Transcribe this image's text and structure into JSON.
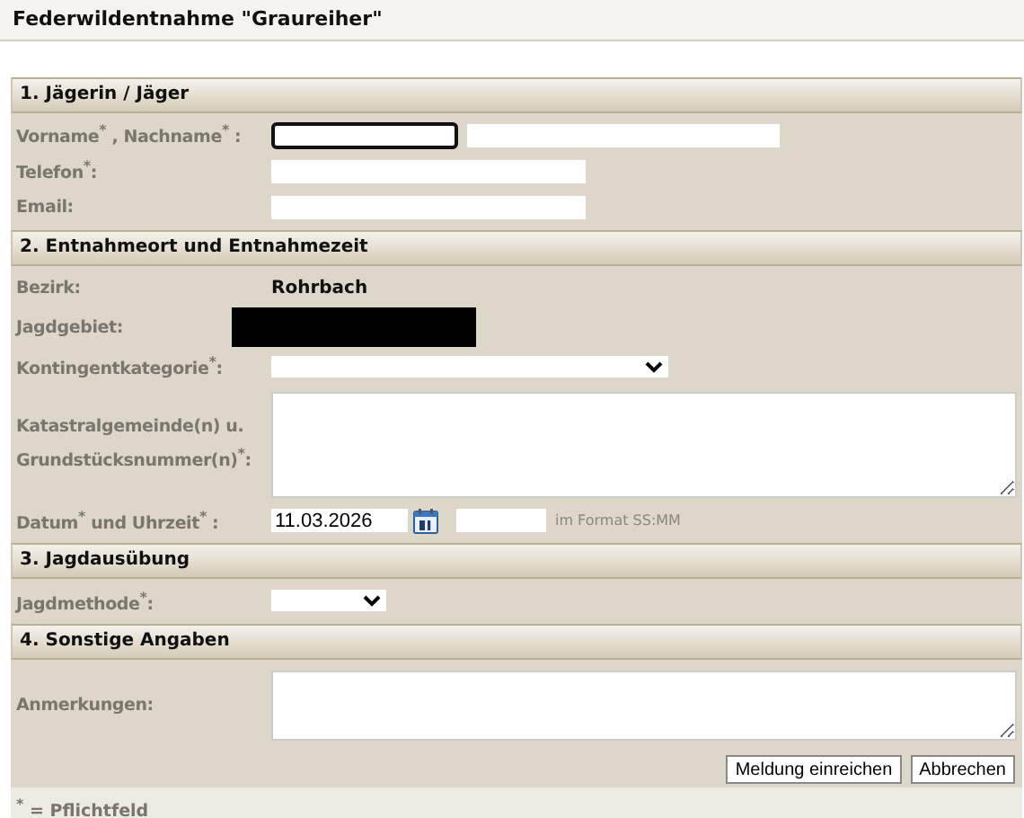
{
  "title": "Federwildentnahme \"Graureiher\"",
  "sections": [
    {
      "heading": "1. Jägerin / Jäger",
      "rows": [
        {
          "label": "Vorname$^{*}$ , Nachname$^{*}$ :",
          "fields": [
            {
              "kind": "text",
              "focused": true
            },
            {
              "kind": "text",
              "focused": false
            }
          ]
        },
        {
          "label": "Telefon$^{*}$:",
          "fields": [
            {
              "kind": "text",
              "focused": false
            }
          ]
        },
        {
          "label": "Email:",
          "fields": [
            {
              "kind": "text",
              "focused": false
            }
          ]
        }
      ]
    },
    {
      "heading": "2. Entnahmeort und Entnahmezeit",
      "rows": [
        {
          "label": "Bezirk:",
          "fields": [
            {
              "kind": "static",
              "text": "Rohrbach"
            }
          ]
        },
        {
          "label": "Jagdgebiet:",
          "fields": [
            {
              "kind": "redacted"
            }
          ]
        },
        {
          "label": "Kontingentkategorie$^{*}$:",
          "fields": [
            {
              "kind": "select"
            }
          ]
        },
        {
          "label": "Katastralgemeinde(n) u. Grundstücksnummer(n)$^{*}$:",
          "fields": [
            {
              "kind": "textarea"
            }
          ]
        },
        {
          "label": "Datum$^{*}$  und Uhrzeit$^{*}$ :",
          "fields": [
            {
              "kind": "date",
              "value": "11.03.2026"
            },
            {
              "kind": "calendar"
            },
            {
              "kind": "time"
            },
            {
              "kind": "hint",
              "text": "im Format SS:MM"
            }
          ]
        }
      ]
    },
    {
      "heading": "3. Jagdausübung",
      "rows": [
        {
          "label": "Jagdmethode$^{*}$:",
          "fields": [
            {
              "kind": "select"
            }
          ]
        }
      ]
    },
    {
      "heading": "4. Sonstige Angaben",
      "rows": [
        {
          "label": "Anmerkungen:",
          "fields": [
            {
              "kind": "textarea"
            }
          ]
        }
      ]
    }
  ],
  "buttons": [
    "Meldung einreichen",
    "Abbrechen"
  ],
  "footnote": "$^{*}$ = Pflichtfeld"
}
